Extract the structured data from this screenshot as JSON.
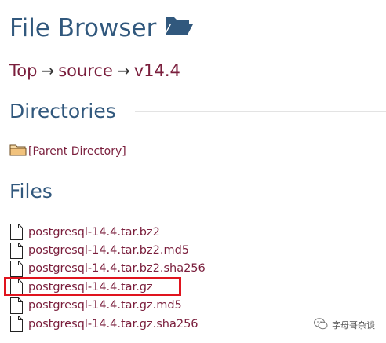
{
  "header": {
    "title": "File Browser",
    "icon": "folder-open-icon"
  },
  "breadcrumb": {
    "items": [
      "Top",
      "source",
      "v14.4"
    ],
    "separator": "→"
  },
  "directories": {
    "heading": "Directories",
    "items": [
      {
        "label": "[Parent Directory]",
        "icon": "folder-icon"
      }
    ]
  },
  "files": {
    "heading": "Files",
    "items": [
      {
        "name": "postgresql-14.4.tar.bz2",
        "icon": "file-icon"
      },
      {
        "name": "postgresql-14.4.tar.bz2.md5",
        "icon": "file-icon"
      },
      {
        "name": "postgresql-14.4.tar.bz2.sha256",
        "icon": "file-icon"
      },
      {
        "name": "postgresql-14.4.tar.gz",
        "icon": "file-icon",
        "highlighted": true
      },
      {
        "name": "postgresql-14.4.tar.gz.md5",
        "icon": "file-icon"
      },
      {
        "name": "postgresql-14.4.tar.gz.sha256",
        "icon": "file-icon"
      }
    ]
  },
  "watermark": {
    "text": "字母哥杂谈",
    "icon": "wechat-icon"
  },
  "colors": {
    "heading": "#31587d",
    "link": "#7a1e3c",
    "highlight": "#e0141e",
    "rule": "#e3e3e3"
  }
}
